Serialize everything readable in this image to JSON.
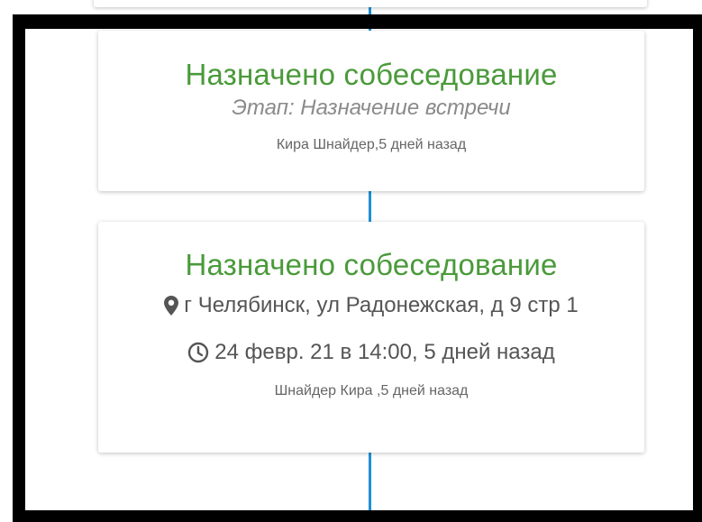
{
  "timeline": {
    "accent_color": "#1e90d6",
    "title_color": "#4a9a3a",
    "events": [
      {
        "title": "Назначено собеседование",
        "stage": "Этап: Назначение встречи",
        "meta": "Кира Шнайдер,5 дней назад"
      },
      {
        "title": "Назначено собеседование",
        "location": "г Челябинск, ул Радонежская, д 9 стр 1",
        "location_icon": "map-marker-icon",
        "datetime": "24 февр. 21 в 14:00, 5 дней назад",
        "datetime_icon": "clock-icon",
        "meta": "Шнайдер Кира ,5 дней назад"
      }
    ]
  }
}
